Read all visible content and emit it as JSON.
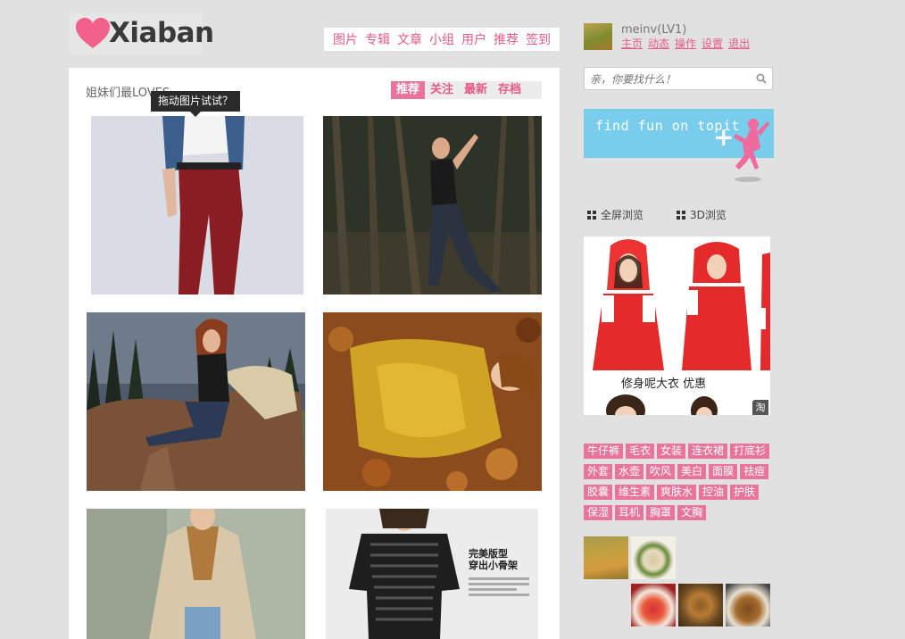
{
  "logo": {
    "text": "Xiaban",
    "heart_color": "#f0608a"
  },
  "top_nav": [
    "图片",
    "专辑",
    "文章",
    "小组",
    "用户",
    "推荐",
    "签到"
  ],
  "user": {
    "name": "meinv(LV1)",
    "links": [
      "主页",
      "动态",
      "操作",
      "设置",
      "退出"
    ]
  },
  "search": {
    "placeholder": "亲，你要找什么！",
    "icon": "search-icon"
  },
  "banner": {
    "text": "find fun on topit"
  },
  "view_options": {
    "fullscreen": "全屏浏览",
    "three_d": "3D浏览"
  },
  "ad": {
    "caption": "修身呢大衣 优惠",
    "badge": "淘"
  },
  "tags": [
    "牛仔裤",
    "毛衣",
    "女装",
    "连衣裙",
    "打底衫",
    "外套",
    "水壶",
    "吹风",
    "美白",
    "面膜",
    "祛痘",
    "胶囊",
    "维生素",
    "爽肤水",
    "控油",
    "护肤",
    "保湿",
    "耳机",
    "胸罩",
    "文胸"
  ],
  "main": {
    "title": "姐妹们最LOVES",
    "tabs": [
      "推荐",
      "关注",
      "最新",
      "存档"
    ],
    "active_tab": "推荐",
    "tooltip": "拖动图片试试？",
    "photo_overlay": {
      "line1": "完美版型",
      "line2": "穿出小骨架"
    }
  },
  "colors": {
    "accent": "#e85a86",
    "tag_bg": "#e8739b",
    "page_bg": "#e1e1e1",
    "banner_bg": "#78ccec"
  }
}
